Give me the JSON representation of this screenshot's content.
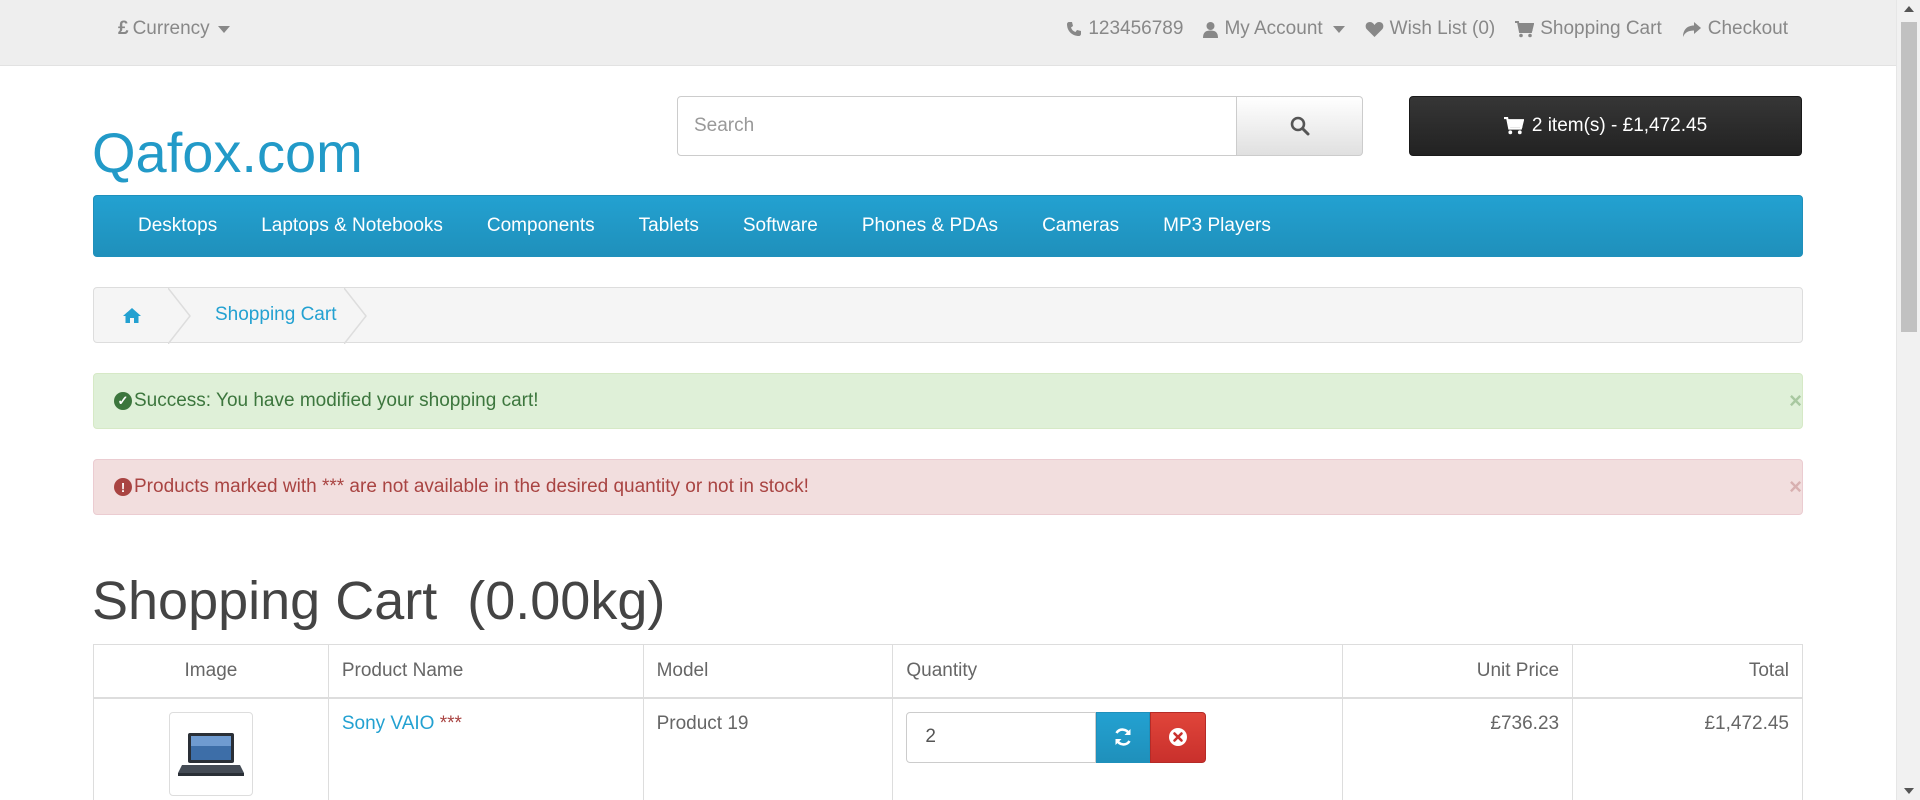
{
  "topbar": {
    "currency_symbol": "£",
    "currency_label": "Currency",
    "phone": "123456789",
    "my_account": "My Account",
    "wish_list": "Wish List (0)",
    "shopping_cart": "Shopping Cart",
    "checkout": "Checkout"
  },
  "header": {
    "logo": "Qafox.com",
    "search_placeholder": "Search",
    "cart_button": "2 item(s) - £1,472.45"
  },
  "menu": {
    "items": [
      "Desktops",
      "Laptops & Notebooks",
      "Components",
      "Tablets",
      "Software",
      "Phones & PDAs",
      "Cameras",
      "MP3 Players"
    ]
  },
  "breadcrumb": {
    "current": "Shopping Cart"
  },
  "alerts": {
    "success": "Success: You have modified your shopping cart!",
    "danger": "Products marked with *** are not available in the desired quantity or not in stock!",
    "close": "×"
  },
  "page": {
    "title": "Shopping Cart  (0.00kg)"
  },
  "cart_table": {
    "headers": {
      "image": "Image",
      "product_name": "Product Name",
      "model": "Model",
      "quantity": "Quantity",
      "unit_price": "Unit Price",
      "total": "Total"
    },
    "rows": [
      {
        "product_name": "Sony VAIO",
        "stock_flag": "***",
        "model": "Product 19",
        "quantity": "2",
        "unit_price": "£736.23",
        "total": "£1,472.45"
      }
    ]
  },
  "colors": {
    "brand_blue": "#229ac8",
    "danger_red": "#a94442",
    "success_green": "#3c763d"
  }
}
